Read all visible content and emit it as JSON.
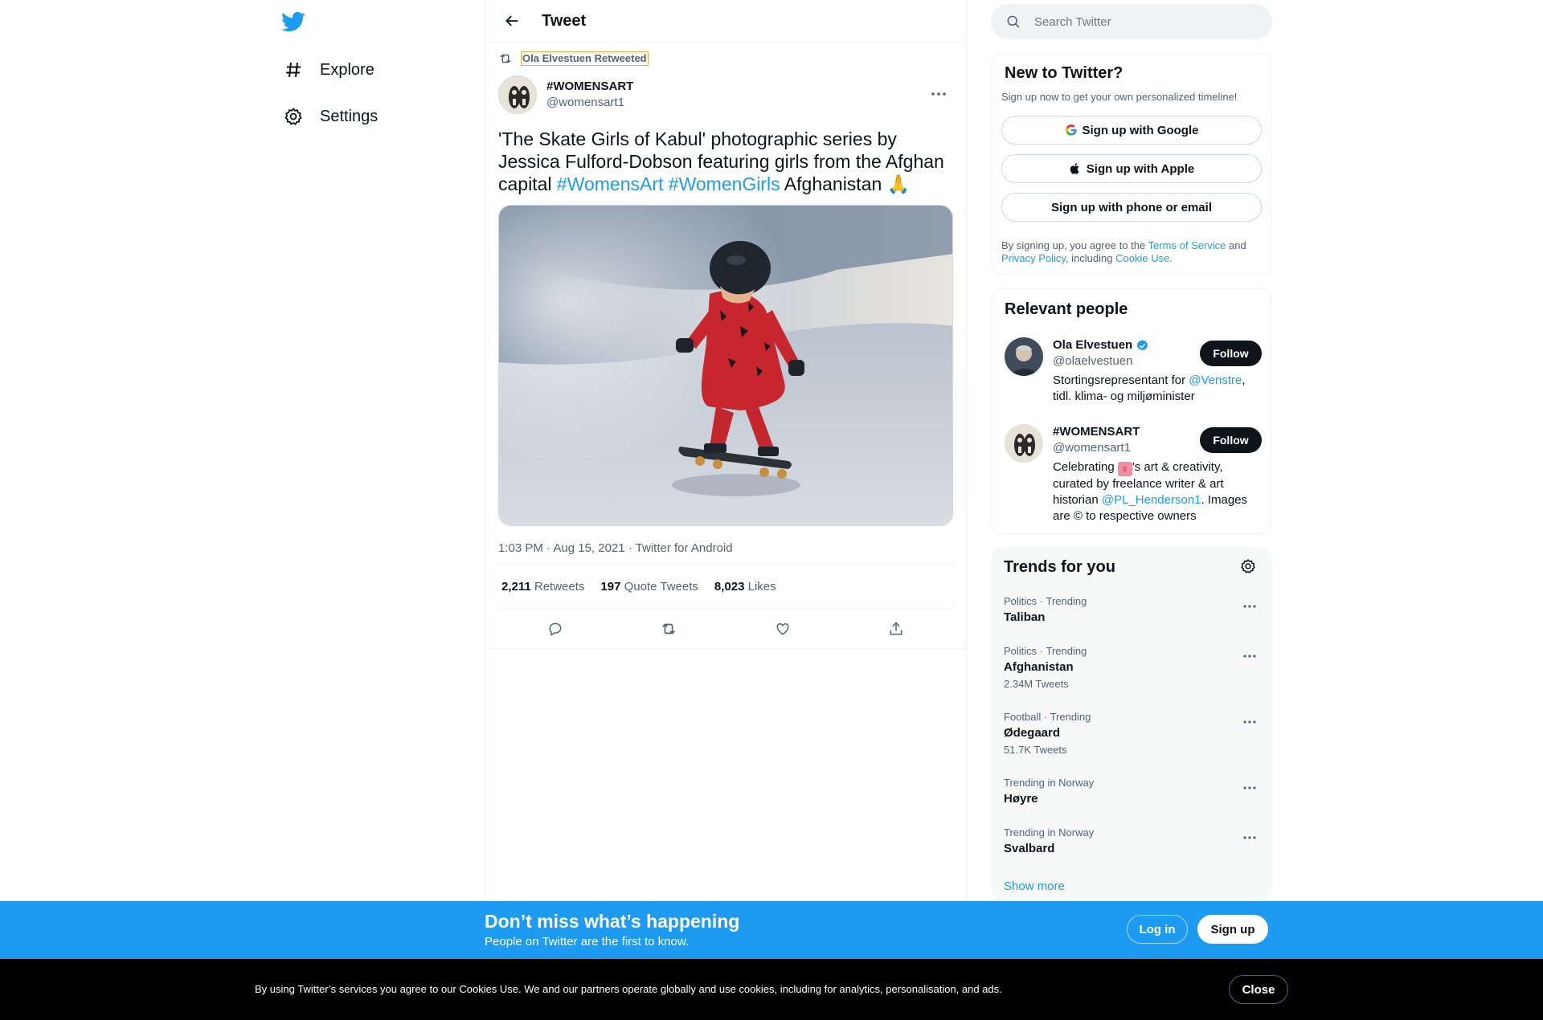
{
  "nav": {
    "items": [
      {
        "label": "Explore",
        "icon": "hashtag-icon"
      },
      {
        "label": "Settings",
        "icon": "gear-icon"
      }
    ]
  },
  "header": {
    "title": "Tweet"
  },
  "tweet": {
    "retweeted_by": "Ola Elvestuen Retweeted",
    "author_name": "#WOMENSART",
    "author_handle": "@womensart1",
    "text_prefix": "'The Skate Girls of Kabul' photographic series by Jessica Fulford-Dobson featuring girls from the Afghan capital ",
    "hashtag1": "#WomensArt",
    "hashtag2": "#WomenGirls",
    "text_suffix": " Afghanistan 🙏",
    "meta": "1:03 PM · Aug 15, 2021 · Twitter for Android",
    "stats": {
      "retweets_count": "2,211",
      "retweets_label": " Retweets",
      "quotes_count": "197",
      "quotes_label": " Quote Tweets",
      "likes_count": "8,023",
      "likes_label": " Likes"
    }
  },
  "search": {
    "placeholder": "Search Twitter"
  },
  "new_to_twitter": {
    "title": "New to Twitter?",
    "subtitle": "Sign up now to get your own personalized timeline!",
    "google_btn": "Sign up with Google",
    "apple_btn": "Sign up with Apple",
    "phone_btn": "Sign up with phone or email",
    "legal_1": "By signing up, you agree to the ",
    "tos": "Terms of Service",
    "legal_2": " and ",
    "privacy": "Privacy Policy",
    "legal_3": ", including ",
    "cookie_use": "Cookie Use."
  },
  "relevant_people": {
    "title": "Relevant people",
    "people": [
      {
        "name": "Ola Elvestuen",
        "handle": "@olaelvestuen",
        "bio_1": "Stortingsrepresentant for ",
        "bio_link": "@Venstre",
        "bio_2": ", tidl. klima- og miljøminister",
        "follow": "Follow"
      },
      {
        "name": "#WOMENSART",
        "handle": "@womensart1",
        "bio_1": "Celebrating ",
        "bio_emoji": "♀",
        "bio_2": "'s art & creativity, curated by freelance writer & art historian ",
        "bio_link": "@PL_Henderson1",
        "bio_3": ". Images are © to respective owners",
        "follow": "Follow"
      }
    ]
  },
  "trends": {
    "title": "Trends for you",
    "items": [
      {
        "meta": "Politics · Trending",
        "name": "Taliban",
        "count": ""
      },
      {
        "meta": "Politics · Trending",
        "name": "Afghanistan",
        "count": "2.34M Tweets"
      },
      {
        "meta": "Football · Trending",
        "name": "Ødegaard",
        "count": "51.7K Tweets"
      },
      {
        "meta": "Trending in Norway",
        "name": "Høyre",
        "count": ""
      },
      {
        "meta": "Trending in Norway",
        "name": "Svalbard",
        "count": ""
      }
    ],
    "show_more": "Show more"
  },
  "banner": {
    "title": "Don’t miss what’s happening",
    "subtitle": "People on Twitter are the first to know.",
    "login": "Log in",
    "signup": "Sign up"
  },
  "cookie": {
    "text": "By using Twitter’s services you agree to our Cookies Use. We and our partners operate globally and use cookies, including for analytics, personalisation, and ads.",
    "close": "Close"
  },
  "colors": {
    "accent": "#1d9bf0",
    "text": "#0f1419",
    "muted": "#536471"
  }
}
